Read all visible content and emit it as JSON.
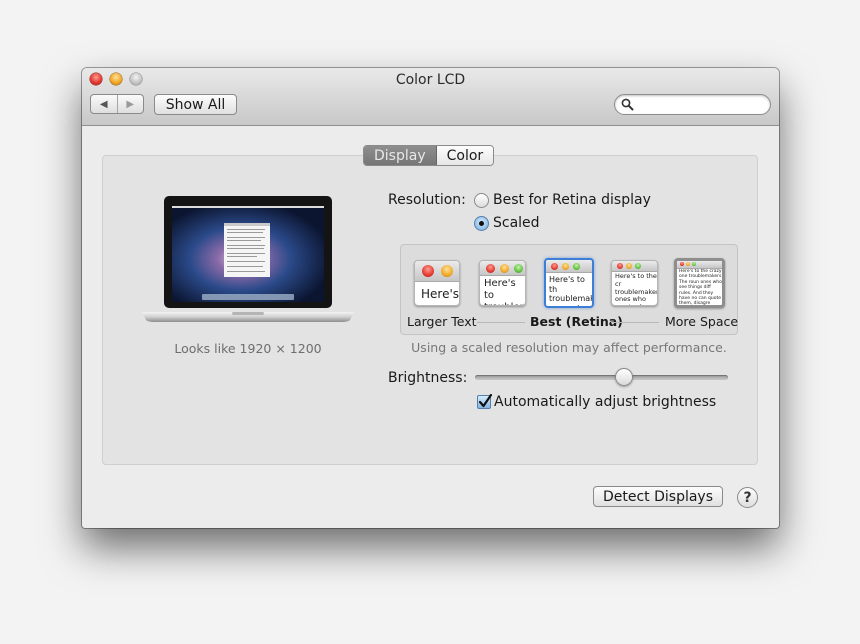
{
  "window": {
    "title": "Color LCD",
    "nav_back_icon": "back-arrow-icon",
    "nav_forward_icon": "forward-arrow-icon",
    "show_all_label": "Show All",
    "search": {
      "value": "",
      "placeholder": "",
      "icon": "search-icon"
    }
  },
  "tabs": [
    {
      "label": "Display",
      "active": true
    },
    {
      "label": "Color",
      "active": false
    }
  ],
  "display_preview": {
    "image": "macbook-pro-laptop",
    "caption": "Looks like 1920 × 1200"
  },
  "resolution": {
    "label": "Resolution:",
    "options": [
      {
        "label": "Best for Retina display",
        "selected": false
      },
      {
        "label": "Scaled",
        "selected": true
      }
    ],
    "scaled_choices": [
      {
        "preview_text": "Here's",
        "selected": false
      },
      {
        "preview_text": "Here's to troublem",
        "selected": false
      },
      {
        "preview_text": "Here's to th troublemak ones who",
        "selected": true
      },
      {
        "preview_text": "Here's to the cr troublemakers. ones who see t rules. And they",
        "selected": false
      },
      {
        "preview_text": "Here's to the crazy one troublemakers. The roun ones who see things diff rules. And they have no can quote them, disagre them. About the only th Because they change th",
        "selected": false
      }
    ],
    "scale_labels": {
      "left": "Larger Text",
      "center": "Best (Retina)",
      "right": "More Space"
    },
    "warning": "Using a scaled resolution may affect performance."
  },
  "brightness": {
    "label": "Brightness:",
    "value": 0.59,
    "auto_adjust_label": "Automatically adjust brightness",
    "auto_adjust_checked": true
  },
  "footer": {
    "detect_displays_label": "Detect Displays",
    "help_label": "?"
  },
  "colors": {
    "window_bg": "#ececec",
    "panel_bg": "#e3e3e3",
    "selection_blue": "#3d7fd6",
    "active_tab": "#7e7e7e"
  }
}
